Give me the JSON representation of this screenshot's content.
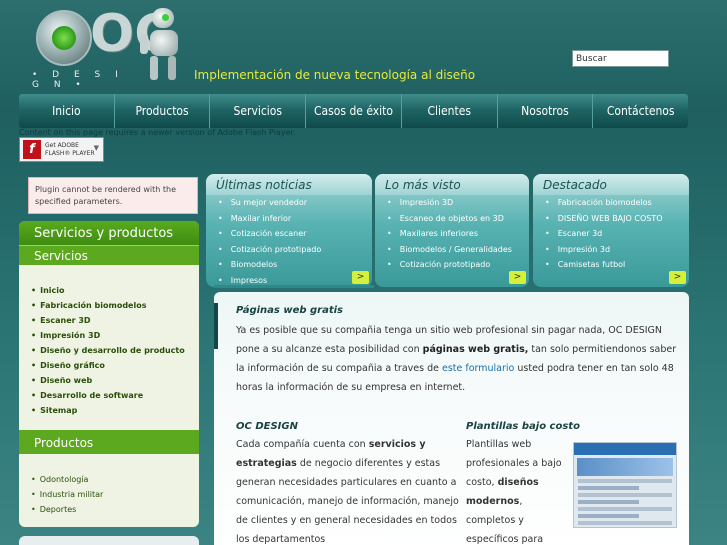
{
  "header": {
    "logo_text": "OC",
    "logo_sub": "• D E S I G N •",
    "tagline": "Implementación de nueva tecnología al diseño",
    "search_value": "Buscar"
  },
  "nav": [
    "Inicio",
    "Productos",
    "Servicios",
    "Casos de éxito",
    "Clientes",
    "Nosotros",
    "Contáctenos"
  ],
  "flash": {
    "note": "Content on this page requires a newer version of Adobe Flash Player.",
    "button_line1": "Get ADOBE",
    "button_line2": "FLASH® PLAYER"
  },
  "plugin_message": "Plugin cannot be rendered with the specified parameters.",
  "sidebar": {
    "title": "Servicios y productos",
    "section1": "Servicios",
    "servicios": [
      "Inicio",
      "Fabricación biomodelos",
      "Escaner 3D",
      "Impresión 3D",
      "Diseño y desarrollo de producto",
      "Diseño gráfico",
      "Diseño web",
      "Desarrollo de software",
      "Sitemap"
    ],
    "section2": "Productos",
    "productos": [
      "Odontología",
      "Industria militar",
      "Deportes"
    ]
  },
  "boxes": [
    {
      "title": "Últimas noticias",
      "items": [
        "Su mejor vendedor",
        "Maxilar inferior",
        "Cotización escaner",
        "Cotización prototipado",
        "Biomodelos",
        "Impresos"
      ]
    },
    {
      "title": "Lo más visto",
      "items": [
        "Impresión 3D",
        "Escaneo de objetos en 3D",
        "Maxilares inferiores",
        "Biomodelos / Generalidades",
        "Cotización prototipado"
      ]
    },
    {
      "title": "Destacado",
      "items": [
        "Fabricación biomodelos",
        "DISEÑO WEB BAJO COSTO",
        "Escaner 3d",
        "Impresión 3d",
        "Camisetas futbol"
      ]
    }
  ],
  "arrow": ">",
  "main": {
    "heading": "Páginas web gratis",
    "intro_1": "Ya es posible que su compañia tenga un sitio web profesional sin pagar nada, OC DESIGN pone a su alcanze esta posibilidad con ",
    "intro_bold": "páginas web gratis,",
    "intro_2": " tan solo permitiendonos saber la información de su compañia a traves de ",
    "intro_link": "este formulario",
    "intro_3": " usted podra tener en tan solo 48 horas la información de su empresa en internet.",
    "col1_title": "OC DESIGN",
    "col1_a": "Cada compañía cuenta con ",
    "col1_b": "servicios y estrategias",
    "col1_c": " de negocio diferentes y estas generan necesidades particulares en cuanto a comunicación, manejo de información, manejo de clientes y en general necesidades en todos los departamentos",
    "col2_title": "Plantillas bajo costo",
    "col2_a": "Plantillas web profesionales a bajo costo, ",
    "col2_b": "diseños modernos",
    "col2_c": ", completos y específicos para"
  }
}
